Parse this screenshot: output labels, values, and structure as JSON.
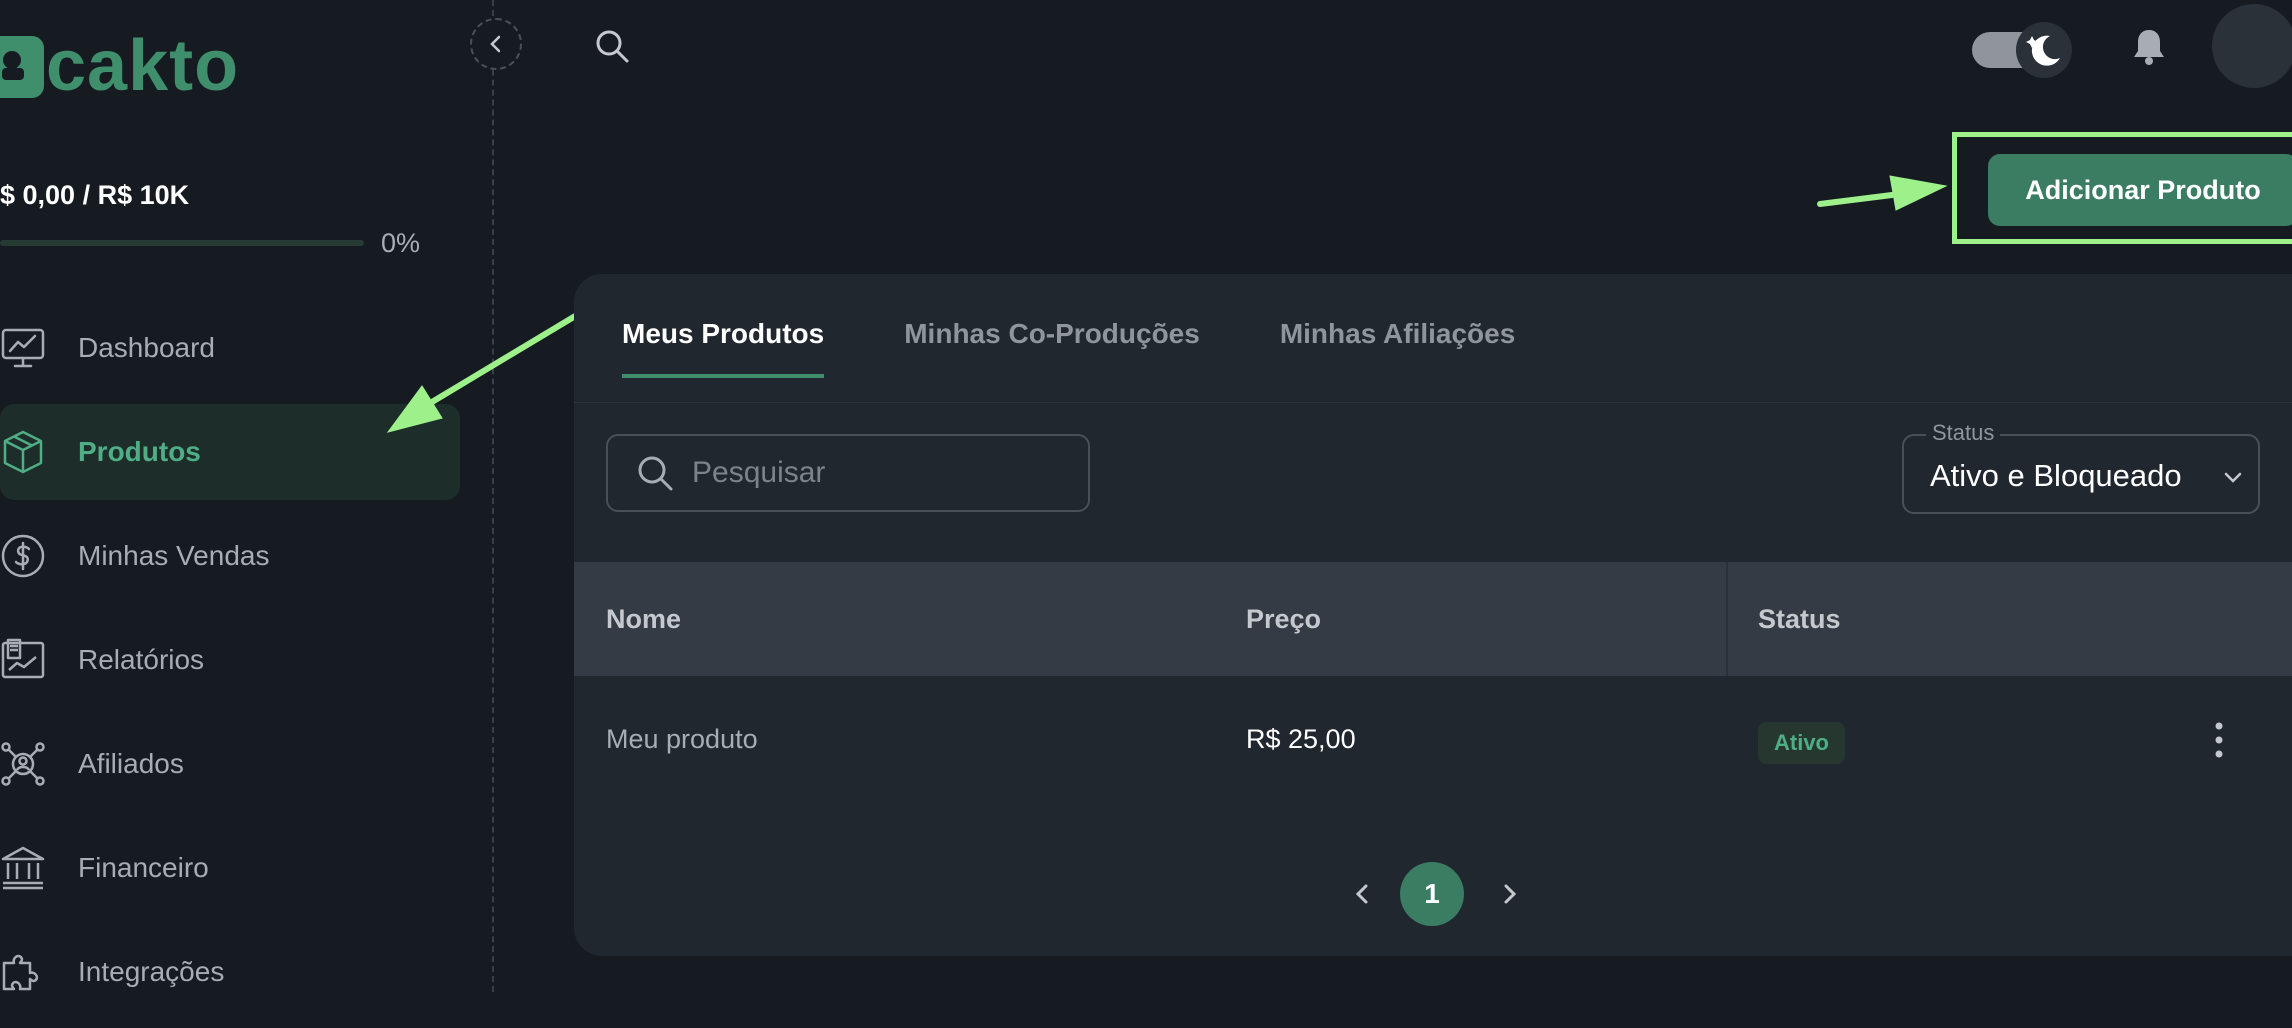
{
  "brand": {
    "logo_text": "cakto",
    "color": "#3f8f6c"
  },
  "revenue": {
    "label": "$ 0,00 / R$ 10K",
    "progress_pct": 0,
    "progress_label": "0%"
  },
  "sidebar": {
    "items": [
      {
        "label": "Dashboard",
        "icon": "chart-monitor-icon",
        "active": false
      },
      {
        "label": "Produtos",
        "icon": "box-icon",
        "active": true
      },
      {
        "label": "Minhas Vendas",
        "icon": "dollar-circle-icon",
        "active": false
      },
      {
        "label": "Relatórios",
        "icon": "report-icon",
        "active": false
      },
      {
        "label": "Afiliados",
        "icon": "network-user-icon",
        "active": false
      },
      {
        "label": "Financeiro",
        "icon": "bank-icon",
        "active": false
      },
      {
        "label": "Integrações",
        "icon": "puzzle-icon",
        "active": false
      }
    ]
  },
  "header": {
    "theme": "dark"
  },
  "actions": {
    "add_product_label": "Adicionar Produto"
  },
  "tabs": [
    {
      "label": "Meus Produtos",
      "active": true
    },
    {
      "label": "Minhas Co-Produções",
      "active": false
    },
    {
      "label": "Minhas Afiliações",
      "active": false
    }
  ],
  "filters": {
    "search_placeholder": "Pesquisar",
    "status_label": "Status",
    "status_value": "Ativo e Bloqueado"
  },
  "table": {
    "columns": [
      "Nome",
      "Preço",
      "Status"
    ],
    "rows": [
      {
        "name": "Meu produto",
        "price": "R$ 25,00",
        "status": "Ativo"
      }
    ]
  },
  "pagination": {
    "current_page": "1"
  },
  "colors": {
    "accent": "#3b7d63",
    "highlight": "#9df08a",
    "background": "#161b22",
    "card": "#21272f"
  }
}
